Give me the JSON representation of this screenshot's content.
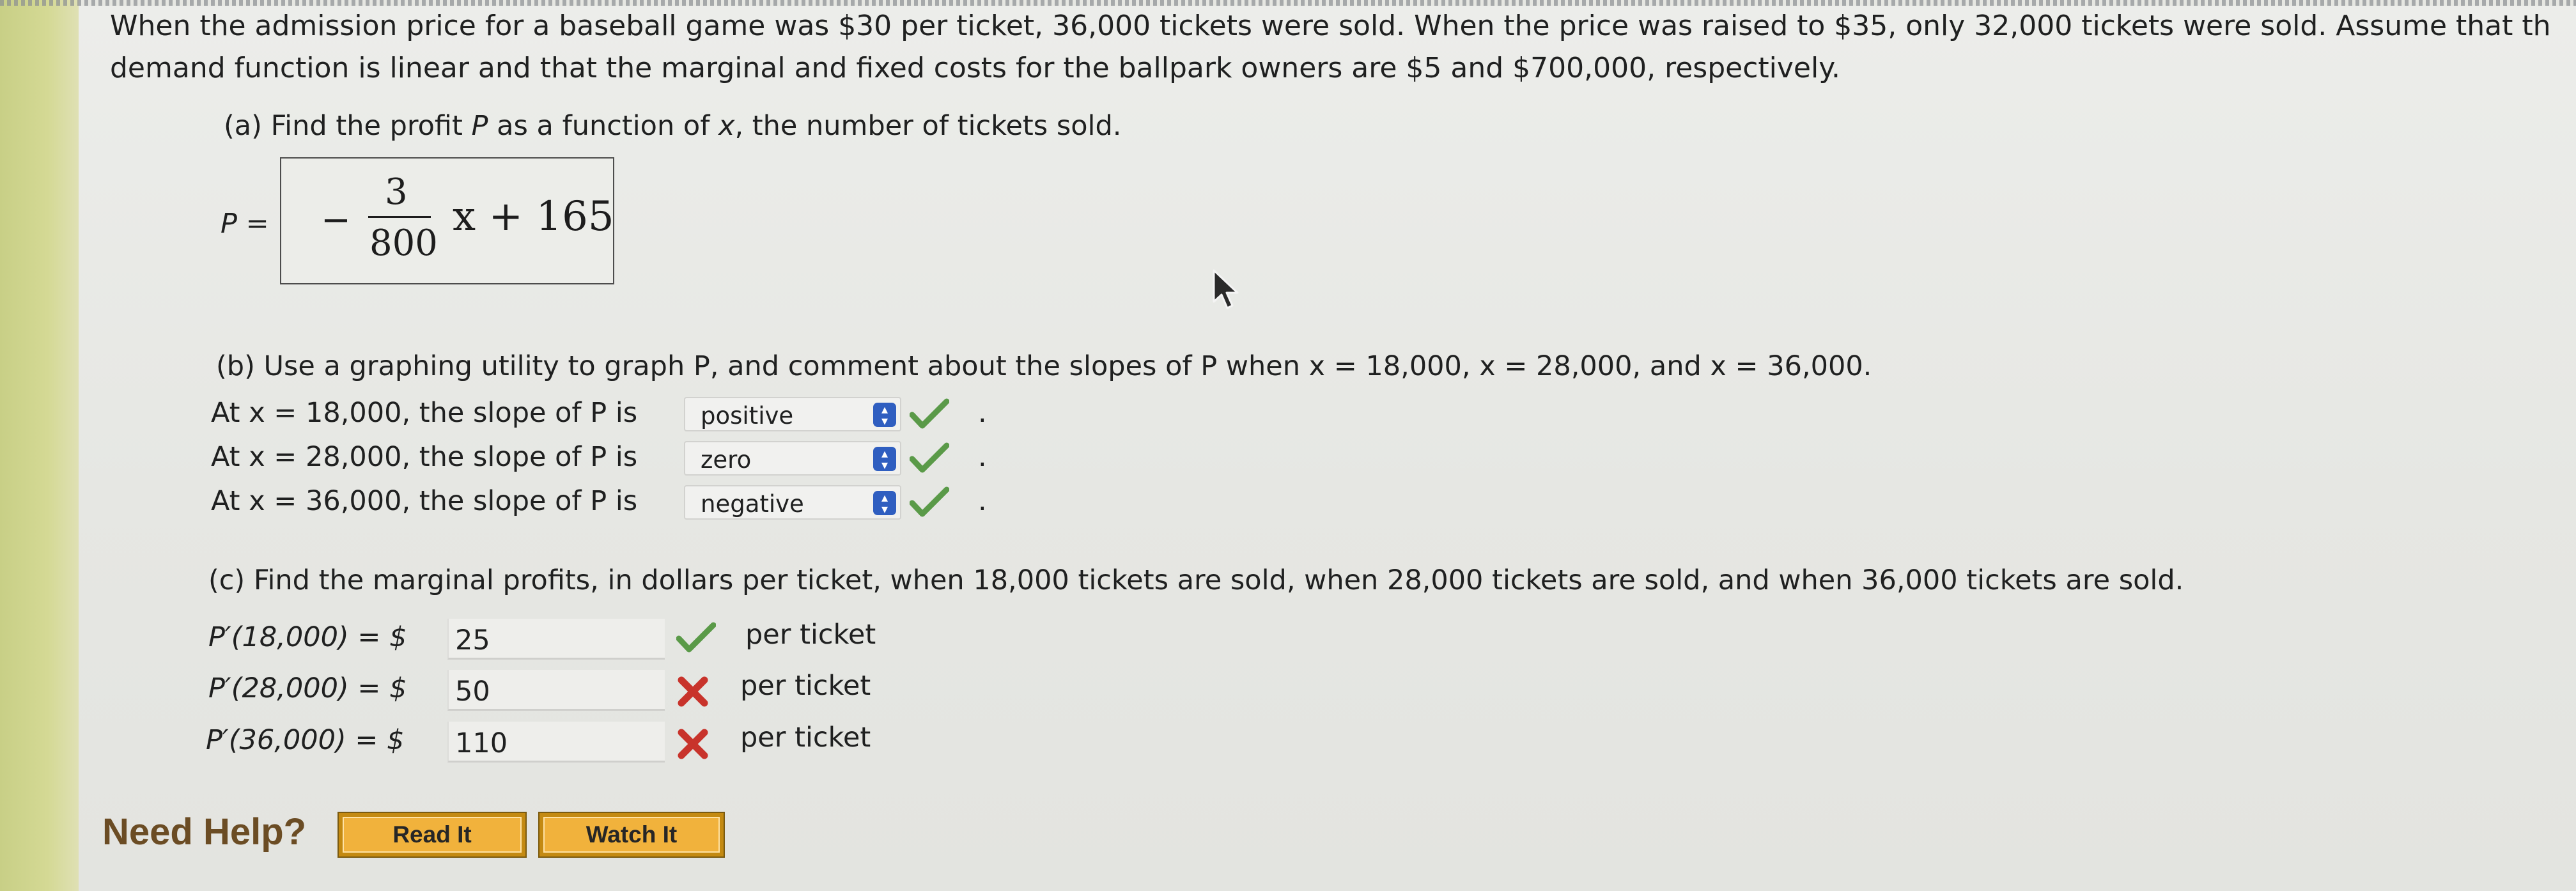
{
  "problem": {
    "line1": "When the admission price for a baseball game was $30 per ticket, 36,000 tickets were sold. When the price was raised to $35, only 32,000 tickets were sold. Assume that th",
    "line2": "demand function is linear and that the marginal and fixed costs for the ballpark owners are $5 and $700,000, respectively."
  },
  "part_a": {
    "prompt_pre": "(a) Find the profit ",
    "prompt_var": "P",
    "prompt_mid": " as a function of ",
    "prompt_x": "x",
    "prompt_post": ", the number of tickets sold.",
    "answer_label_var": "P",
    "answer_label_eq": " =",
    "answer": {
      "minus": "−",
      "numerator": "3",
      "denominator": "800",
      "rest": "x + 165"
    }
  },
  "part_b": {
    "prompt": "(b) Use a graphing utility to graph P, and comment about the slopes of P when x = 18,000, x = 28,000, and x = 36,000.",
    "rows": [
      {
        "text": "At x = 18,000, the slope of P is",
        "selected": "positive",
        "status": "correct",
        "end": "."
      },
      {
        "text": "At x = 28,000, the slope of P is",
        "selected": "zero",
        "status": "correct",
        "end": "."
      },
      {
        "text": "At x = 36,000, the slope of P is",
        "selected": "negative",
        "status": "correct",
        "end": "."
      }
    ]
  },
  "part_c": {
    "prompt": "(c) Find the marginal profits, in dollars per ticket, when 18,000 tickets are sold, when 28,000 tickets are sold, and when 36,000 tickets are sold.",
    "rows": [
      {
        "label": "P′(18,000)  =  $",
        "value": "25",
        "status": "correct",
        "unit": "per ticket"
      },
      {
        "label": "P′(28,000)  =  $",
        "value": "50",
        "status": "incorrect",
        "unit": "per ticket"
      },
      {
        "label": "P′(36,000)  =  $",
        "value": "110",
        "status": "incorrect",
        "unit": "per ticket"
      }
    ]
  },
  "help": {
    "title": "Need Help?",
    "read_it": "Read It",
    "watch_it": "Watch It"
  },
  "icons": {
    "correct": "check-icon",
    "incorrect": "x-mark-icon",
    "dropdown": "up-down-arrows-icon",
    "cursor": "mouse-pointer-icon"
  },
  "colors": {
    "correct_green": "#5a9a48",
    "incorrect_red": "#c8332b",
    "dropdown_blue": "#2f5ec0",
    "help_button": "#f1b23c",
    "help_title": "#6b4c24"
  }
}
